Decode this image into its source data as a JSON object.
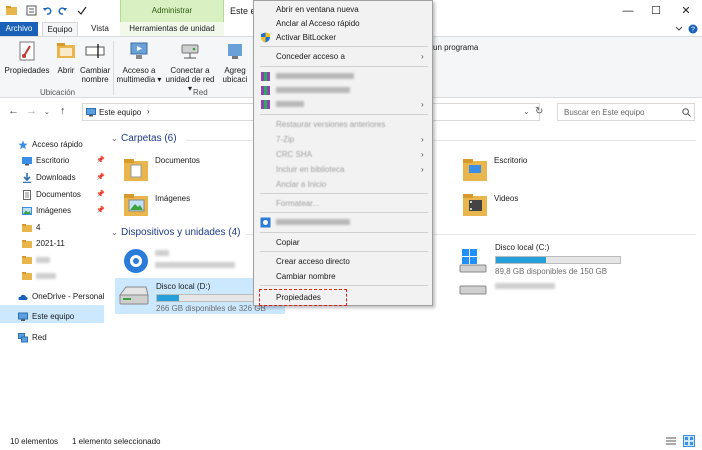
{
  "window": {
    "title": "Este eq",
    "controls": [
      "—",
      "☐",
      "✕"
    ]
  },
  "ribbon_tabs": {
    "archivo": "Archivo",
    "equipo": "Equipo",
    "vista": "Vista",
    "ctx_group": "Administrar",
    "ctx_sub": "Herramientas de unidad"
  },
  "ribbon": {
    "propiedades": "Propiedades",
    "abrir": "Abrir",
    "cambiar": "Cambiar\nnombre",
    "ubicacion_group": "Ubicación",
    "acceso": "Acceso a\nmultimedia ▾",
    "conectar": "Conectar a\nunidad de red ▾",
    "agregar": "Agreg\nubicaci",
    "red_group": "Red",
    "programa": "un programa"
  },
  "address": {
    "path": "Este equipo",
    "search_placeholder": "Buscar en Este equipo"
  },
  "nav": {
    "acceso_rapido": "Acceso rápido",
    "escritorio": "Escritorio",
    "downloads": "Downloads",
    "documentos": "Documentos",
    "imagenes": "Imágenes",
    "f1": "4",
    "f2": "2021-11",
    "onedrive": "OneDrive - Personal",
    "este_equipo": "Este equipo",
    "red": "Red",
    "pin": "📌"
  },
  "content": {
    "carpetas": "Carpetas (6)",
    "documentos": "Documentos",
    "imagenes": "Imágenes",
    "escritorio": "Escritorio",
    "videos": "Videos",
    "dispositivos": "Dispositivos y unidades (4)",
    "disco_c": "Disco local (C:)",
    "disco_c_sub": "89,8 GB disponibles de 150 GB",
    "disco_c_fill": 0.4,
    "disco_d": "Disco local (D:)",
    "disco_d_sub": "266 GB disponibles de 326 GB",
    "disco_d_fill": 0.18
  },
  "context_menu": {
    "abrir_nueva": "Abrir en ventana nueva",
    "anclar_rapido": "Anclar al Acceso rápido",
    "bitlocker": "Activar BitLocker",
    "conceder": "Conceder acceso a",
    "restaurar": "Restaurar versiones anteriores",
    "sevenzip": "7-Zip",
    "crc": "CRC SHA",
    "incluir": "Incluir en biblioteca",
    "anclar_inicio": "Anclar a Inicio",
    "formatear": "Formatear...",
    "copiar": "Copiar",
    "crear_acceso": "Crear acceso directo",
    "cambiar_nombre": "Cambiar nombre",
    "propiedades": "Propiedades"
  },
  "status": {
    "count": "10 elementos",
    "selected": "1 elemento seleccionado"
  },
  "colors": {
    "accent": "#1a62b9",
    "selection": "#cce8ff",
    "highlight": "#d9231d",
    "drive_fill": "#26a0da"
  }
}
